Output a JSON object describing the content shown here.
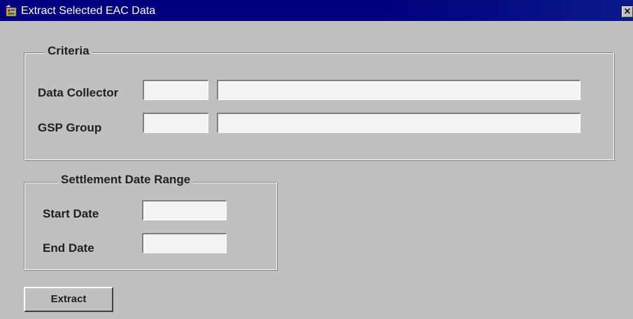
{
  "window": {
    "title": "Extract Selected EAC Data",
    "close_label": "×"
  },
  "criteria": {
    "title": "Criteria",
    "data_collector": {
      "label": "Data Collector",
      "code_value": "",
      "name_value": ""
    },
    "gsp_group": {
      "label": "GSP Group",
      "code_value": "",
      "name_value": ""
    }
  },
  "settlement_date_range": {
    "title": "Settlement Date Range",
    "start_date": {
      "label": "Start Date",
      "value": ""
    },
    "end_date": {
      "label": "End Date",
      "value": ""
    }
  },
  "actions": {
    "extract_label": "Extract"
  },
  "icons": {
    "app": "oracle-forms-app-icon",
    "close": "close-icon"
  },
  "colors": {
    "titlebar": "#000080",
    "background": "#c0c0c0",
    "field": "#f4f4f4"
  }
}
